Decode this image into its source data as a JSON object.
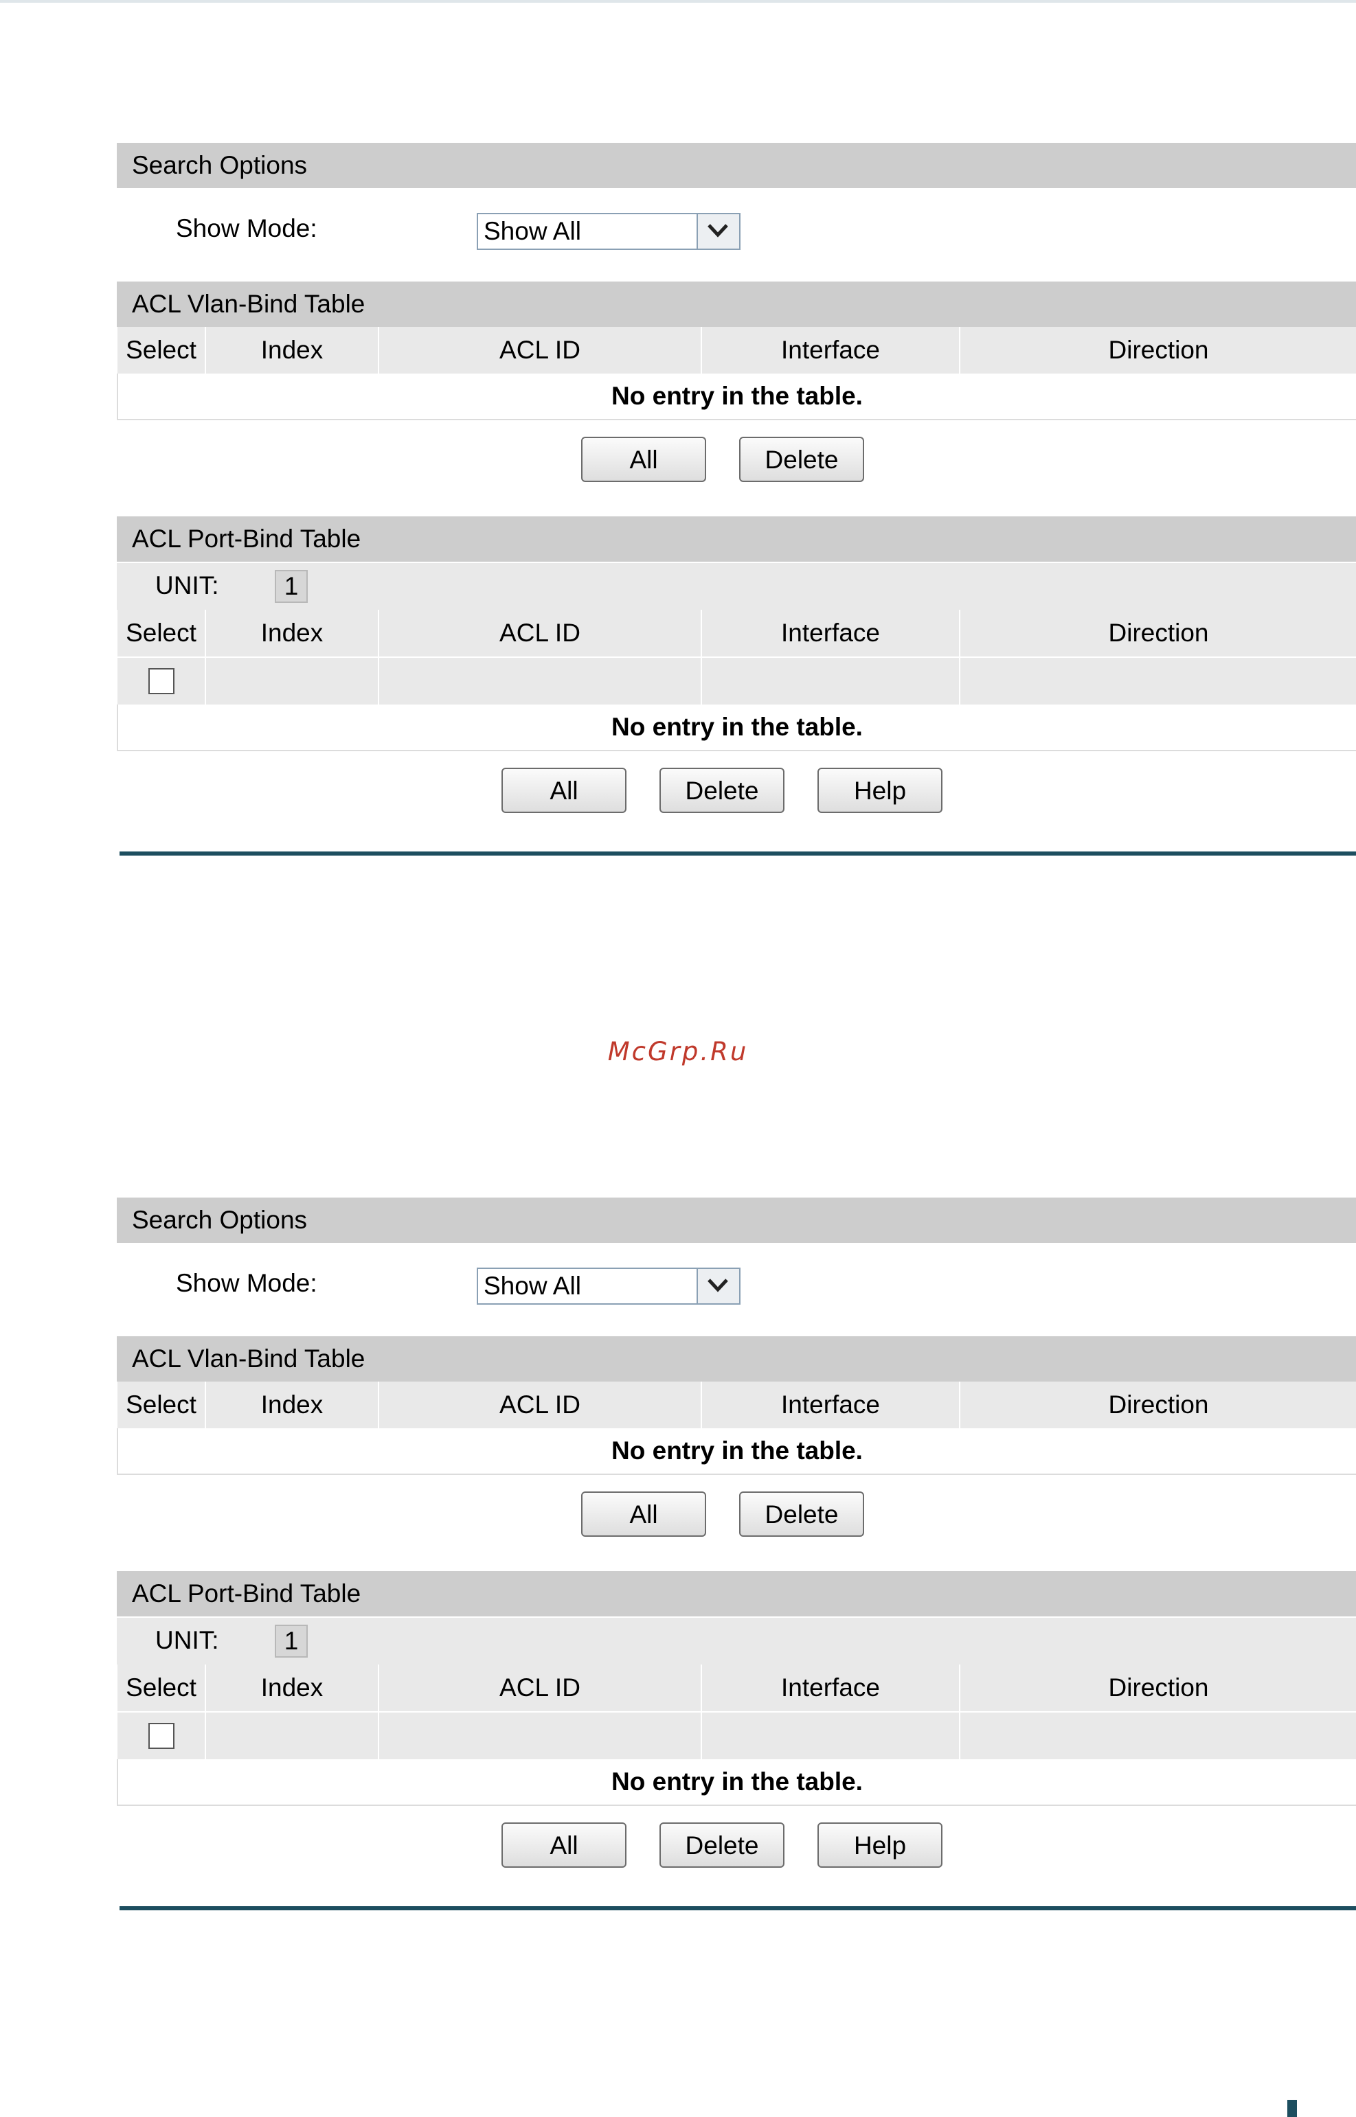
{
  "screens": [
    {
      "search_options": {
        "title": "Search Options",
        "show_mode_label": "Show Mode:",
        "show_mode_value": "Show All"
      },
      "vlan_table": {
        "title": "ACL Vlan-Bind Table",
        "columns": [
          "Select",
          "Index",
          "ACL ID",
          "Interface",
          "Direction"
        ],
        "empty_text": "No entry in the table.",
        "buttons": [
          "All",
          "Delete"
        ]
      },
      "port_table": {
        "title": "ACL Port-Bind Table",
        "unit_label": "UNIT:",
        "unit_value": "1",
        "columns": [
          "Select",
          "Index",
          "ACL ID",
          "Interface",
          "Direction"
        ],
        "empty_text": "No entry in the table.",
        "buttons": [
          "All",
          "Delete",
          "Help"
        ]
      }
    },
    {
      "search_options": {
        "title": "Search Options",
        "show_mode_label": "Show Mode:",
        "show_mode_value": "Show All"
      },
      "vlan_table": {
        "title": "ACL Vlan-Bind Table",
        "columns": [
          "Select",
          "Index",
          "ACL ID",
          "Interface",
          "Direction"
        ],
        "empty_text": "No entry in the table.",
        "buttons": [
          "All",
          "Delete"
        ]
      },
      "port_table": {
        "title": "ACL Port-Bind Table",
        "unit_label": "UNIT:",
        "unit_value": "1",
        "columns": [
          "Select",
          "Index",
          "ACL ID",
          "Interface",
          "Direction"
        ],
        "empty_text": "No entry in the table.",
        "buttons": [
          "All",
          "Delete",
          "Help"
        ]
      }
    }
  ],
  "watermark": "McGrp.Ru",
  "colors": {
    "header_bar": "#cdcdcd",
    "column_header": "#e9e9e9",
    "divider": "#1d4e5f",
    "watermark": "#c0392b"
  }
}
